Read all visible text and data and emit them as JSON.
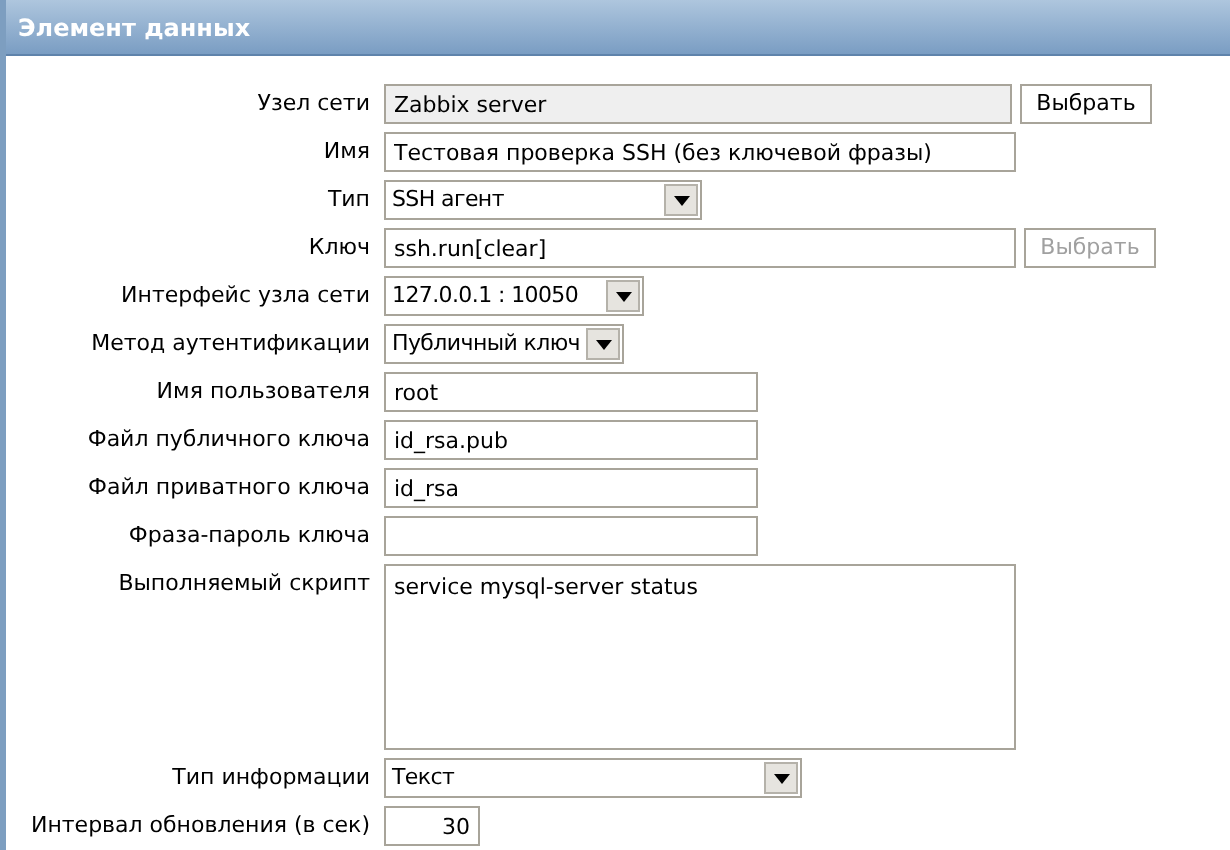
{
  "header": {
    "title": "Элемент данных"
  },
  "rows": [
    {
      "label": "Узел сети",
      "kind": "input",
      "value": "Zabbix server",
      "readonly": true,
      "button": {
        "label": "Выбрать",
        "disabled": false
      }
    },
    {
      "label": "Имя",
      "kind": "input",
      "value": "Тестовая проверка SSH (без ключевой фразы)",
      "readonly": false
    },
    {
      "label": "Тип",
      "kind": "select",
      "value": "SSH агент"
    },
    {
      "label": "Ключ",
      "kind": "input",
      "value": "ssh.run[clear]",
      "readonly": false,
      "button": {
        "label": "Выбрать",
        "disabled": true
      }
    },
    {
      "label": "Интерфейс узла сети",
      "kind": "select",
      "value": "127.0.0.1 : 10050"
    },
    {
      "label": "Метод аутентификации",
      "kind": "select",
      "value": "Публичный ключ"
    },
    {
      "label": "Имя пользователя",
      "kind": "input",
      "value": "root",
      "readonly": false
    },
    {
      "label": "Файл публичного ключа",
      "kind": "input",
      "value": "id_rsa.pub",
      "readonly": false
    },
    {
      "label": "Файл приватного ключа",
      "kind": "input",
      "value": "id_rsa",
      "readonly": false
    },
    {
      "label": "Фраза-пароль ключа",
      "kind": "input",
      "value": "",
      "readonly": false
    },
    {
      "label": "Выполняемый скрипт",
      "kind": "textarea",
      "value": "service mysql-server status"
    },
    {
      "label": "Тип информации",
      "kind": "select",
      "value": "Текст"
    },
    {
      "label": "Интервал обновления (в сек)",
      "kind": "number",
      "value": "30",
      "readonly": false
    }
  ]
}
